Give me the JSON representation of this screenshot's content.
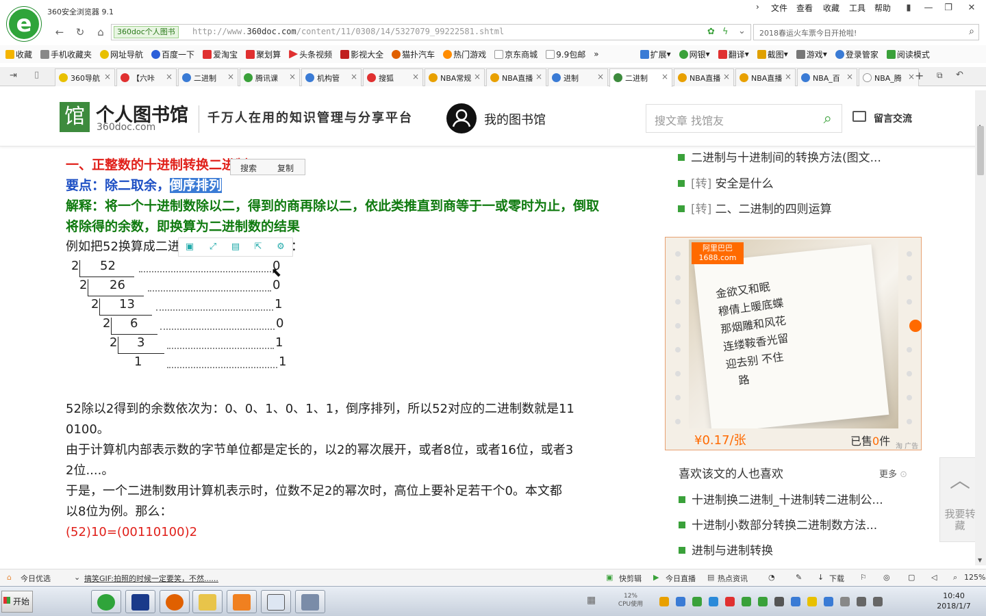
{
  "browser": {
    "title": "360安全浏览器 9.1",
    "menu": [
      "文件",
      "查看",
      "收藏",
      "工具",
      "帮助"
    ],
    "site_chip": "360doc个人图书",
    "url_prefix": "http://www.",
    "url_domain": "360doc.com",
    "url_path": "/content/11/0308/14/5327079_99222581.shtml",
    "search_text": "2018春运火车票今日开抢啦!"
  },
  "favorites": [
    "收藏",
    "手机收藏夹",
    "网址导航",
    "百度一下",
    "爱淘宝",
    "聚划算",
    "头条视频",
    "影视大全",
    "猫扑汽车",
    "热门游戏",
    "京东商城",
    "9.9包邮",
    "扩展",
    "网银",
    "翻译",
    "截图",
    "游戏",
    "登录管家",
    "阅读模式"
  ],
  "tabs": [
    "360导航",
    "【六咔",
    "二进制",
    "腾讯课",
    "机构管",
    "搜狐",
    "NBA常规",
    "NBA直播",
    "进制",
    "二进制",
    "NBA直播",
    "NBA直播",
    "NBA_百",
    "NBA_腾"
  ],
  "site": {
    "brand_name": "个人图书馆",
    "brand_domain": "360doc.com",
    "slogan": "千万人在用的知识管理与分享平台",
    "my_library": "我的图书馆",
    "search_placeholder": "搜文章 找馆友",
    "message": "留言交流"
  },
  "article": {
    "heading": "一、正整数的十进制转换二进制：",
    "point_label": "要点：除二取余，",
    "point_highlight": "倒序排列",
    "explain_1": "解释：将一个十进制数除以二，得到的商再除以二，依此类推直到商等于一或零时为止，倒取",
    "explain_2": "将除得的余数，即换算为二进制数的结果",
    "example": "例如把52换算成二进制数，计算结果如图：",
    "para_1a": "52除以2得到的余数依次为：0、0、1、0、1、1，倒序排列，所以52对应的二进制数就是11",
    "para_1b": "0100。",
    "para_2a": "由于计算机内部表示数的字节单位都是定长的，以2的幂次展开，或者8位，或者16位，或者3",
    "para_2b": "2位....。",
    "para_3a": "于是，一个二进制数用计算机表示时，位数不足2的幂次时，高位上要补足若干个0。本文都",
    "para_3b": "以8位为例。那么：",
    "formula": "(52)10=(00110100)2"
  },
  "division": {
    "divisors": [
      "2",
      "2",
      "2",
      "2",
      "2"
    ],
    "quotients": [
      "52",
      "26",
      "13",
      "6",
      "3",
      "1"
    ],
    "remainders": [
      "0",
      "0",
      "1",
      "0",
      "1",
      "1"
    ]
  },
  "popup": {
    "search": "搜索",
    "copy": "复制"
  },
  "sidebar": {
    "links": [
      {
        "prefix": "",
        "text": "二进制与十进制间的转换方法(图文..."
      },
      {
        "prefix": "[转]",
        "text": " 安全是什么"
      },
      {
        "prefix": "[转]",
        "text": " 二、二进制的四则运算"
      }
    ],
    "likes_title": "喜欢该文的人也喜欢",
    "likes_more": "更多",
    "likes": [
      "十进制换二进制_十进制转二进制公...",
      "十进制小数部分转换二进制数方法...",
      "进制与进制转换"
    ],
    "float_save": "我要转藏"
  },
  "ad": {
    "badge_1": "阿里巴巴",
    "badge_2": "1688.com",
    "poem": "金欲又和眠\n穆倩上暖底蝶\n那烟雕和风花\n连缕鞍香光留\n迎去别 不住\n   路",
    "price": "¥0.17/张",
    "sold_prefix": "已售",
    "sold_count": "0",
    "sold_suffix": "件",
    "tag": "淘 广告"
  },
  "statusbar": {
    "left": "今日优选",
    "news": "搞笑GIF:拍照的时候一定要笑，不然......",
    "items": [
      "快剪辑",
      "今日直播",
      "热点资讯",
      "下载"
    ],
    "zoom": "125%"
  },
  "taskbar": {
    "start": "开始",
    "cpu_value": "12%",
    "cpu_label": "CPU使用",
    "time": "10:40",
    "date": "2018/1/7"
  }
}
